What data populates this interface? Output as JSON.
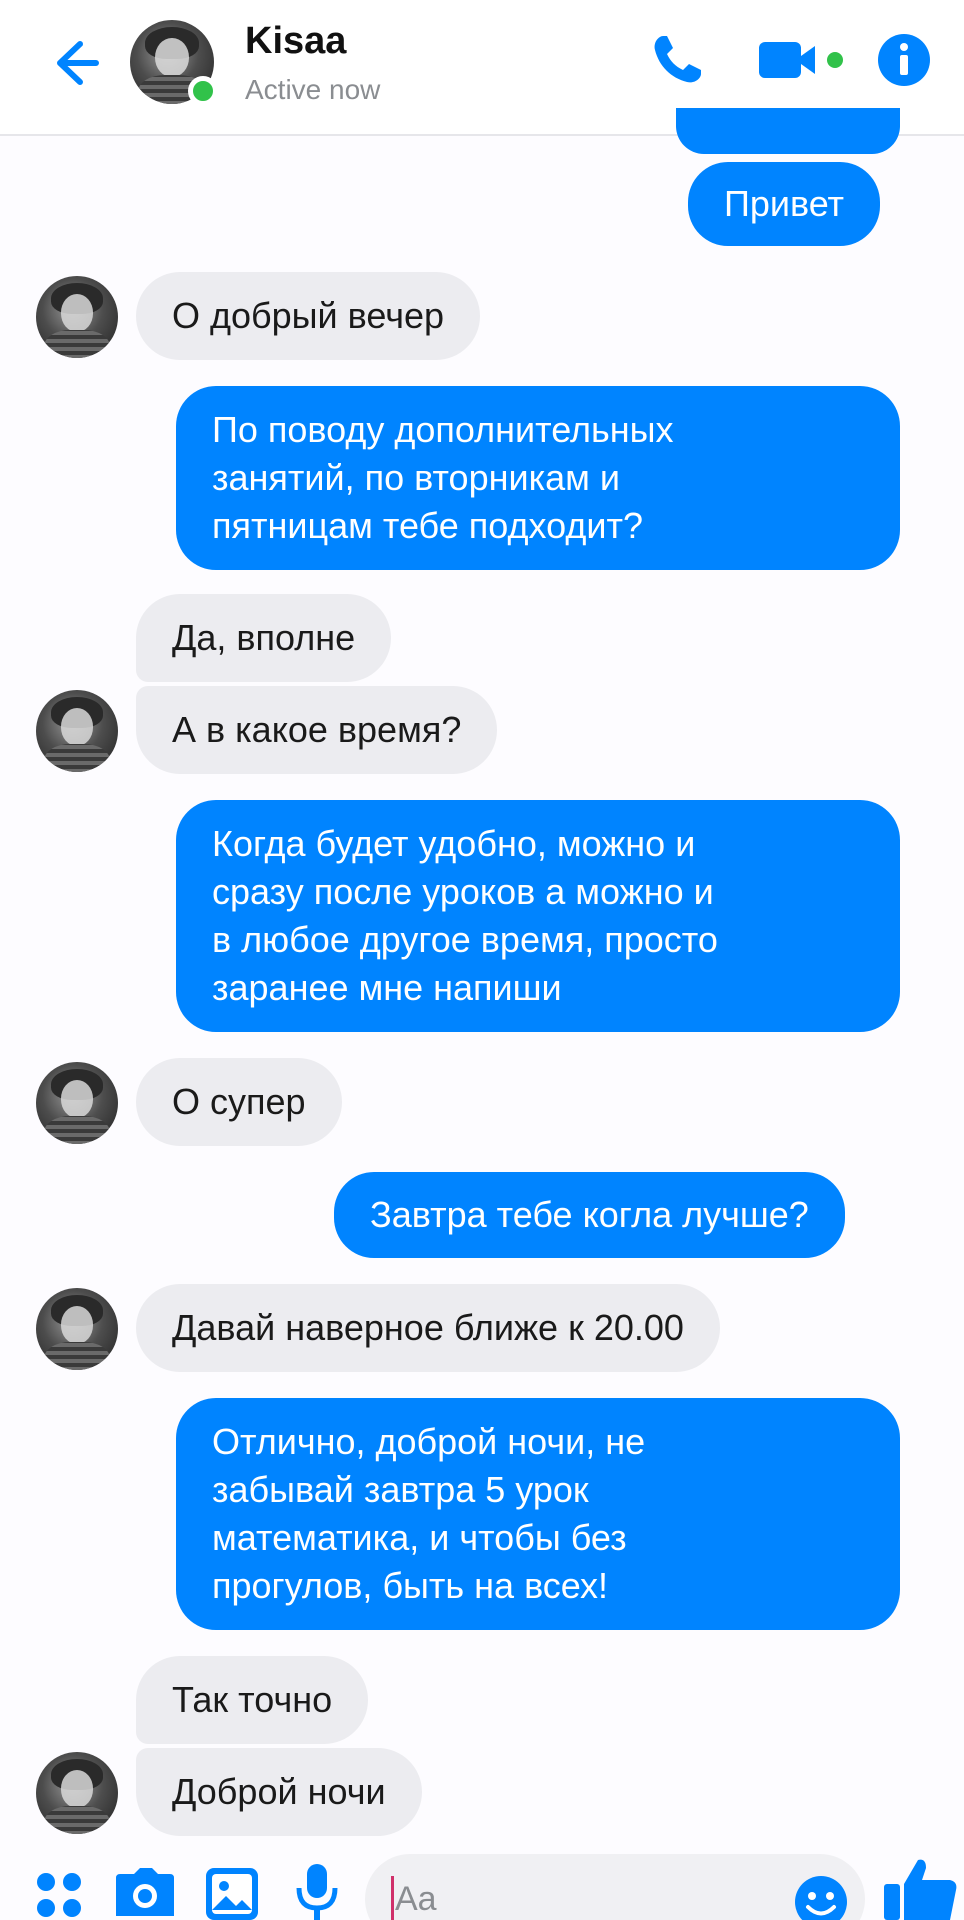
{
  "header": {
    "contact_name": "Kisaa",
    "status": "Active now",
    "accent_color": "#0084ff",
    "online_color": "#31c24a"
  },
  "messages": [
    {
      "dir": "out",
      "text": "Привет"
    },
    {
      "dir": "in",
      "text": "О добрый вечер"
    },
    {
      "dir": "out",
      "text": "По поводу дополнительных\nзанятий,  по вторникам и\nпятницам тебе подходит?"
    },
    {
      "dir": "in",
      "text": "Да, вполне"
    },
    {
      "dir": "in",
      "text": "А в какое время?"
    },
    {
      "dir": "out",
      "text": "Когда будет удобно,  можно и\nсразу после уроков а можно и\nв любое другое время,  просто\nзаранее мне напиши"
    },
    {
      "dir": "in",
      "text": "О супер"
    },
    {
      "dir": "out",
      "text": "Завтра тебе когла лучше?"
    },
    {
      "dir": "in",
      "text": "Давай наверное ближе к 20.00"
    },
    {
      "dir": "out",
      "text": "Отлично, доброй ночи,  не\nзабывай завтра 5 урок\nматематика, и чтобы без\nпрогулов, быть на всех!"
    },
    {
      "dir": "in",
      "text": "Так точно"
    },
    {
      "dir": "in",
      "text": "Доброй ночи"
    }
  ],
  "composer": {
    "placeholder": "Aa",
    "icons": [
      "apps-icon",
      "camera-icon",
      "gallery-icon",
      "microphone-icon",
      "emoji-icon",
      "thumbs-up-icon"
    ]
  }
}
